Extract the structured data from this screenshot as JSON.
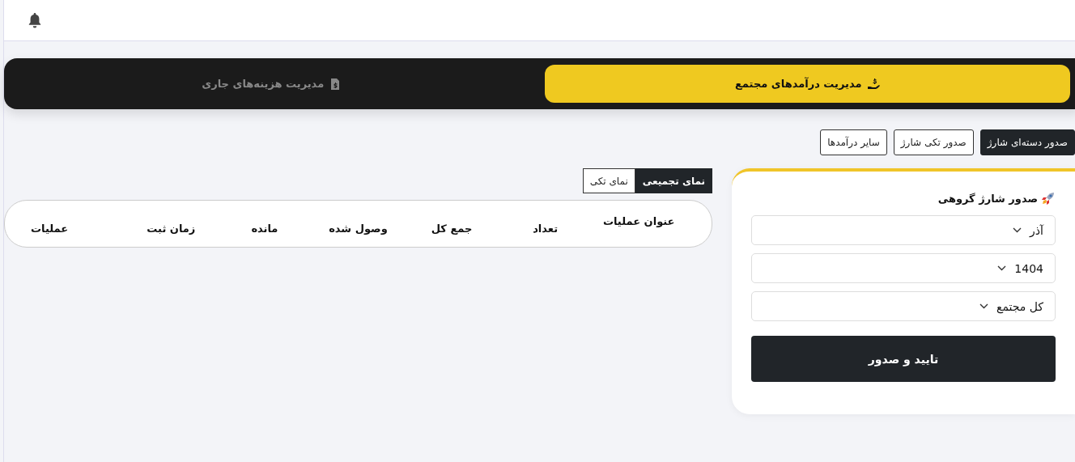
{
  "main_tabs": [
    {
      "label": "مدیریت درآمدهای مجتمع",
      "kind": "income",
      "selected": true
    },
    {
      "label": "مدیریت هزینه‌های جاری",
      "kind": "expense",
      "selected": false
    }
  ],
  "sub_tabs": [
    {
      "label": "صدور دسته‌ای شارژ",
      "selected": true
    },
    {
      "label": "صدور تکی شارژ",
      "selected": false
    },
    {
      "label": "سایر درآمدها",
      "selected": false
    }
  ],
  "charge_form": {
    "title": "صدور شارژ گروهی",
    "fields": [
      {
        "value": "آذر"
      },
      {
        "value": "1404"
      },
      {
        "value": "کل مجتمع"
      }
    ],
    "submit": "تایید و صدور"
  },
  "view_tabs": [
    {
      "label": "نمای تجمیعی",
      "selected": true
    },
    {
      "label": "نمای تکی",
      "selected": false
    }
  ],
  "table": {
    "columns": [
      "عنوان عملیات",
      "تعداد",
      "جمع کل",
      "وصول شده",
      "مانده",
      "زمان ثبت",
      "عملیات"
    ]
  }
}
